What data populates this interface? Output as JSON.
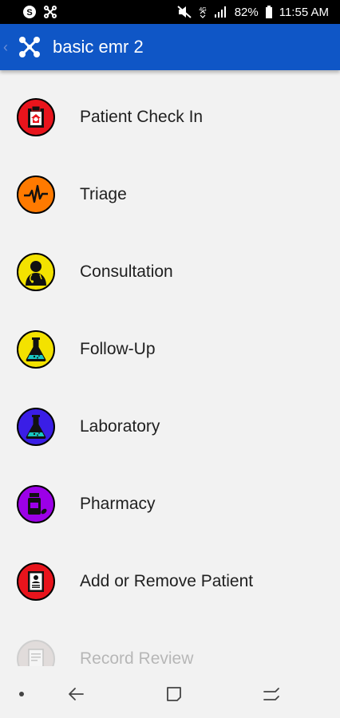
{
  "status": {
    "battery": "82%",
    "time": "11:55 AM"
  },
  "app": {
    "title": "basic emr 2"
  },
  "menu": {
    "items": [
      {
        "label": "Patient Check In",
        "color": "#e8141c",
        "icon": "clipboard-icon"
      },
      {
        "label": "Triage",
        "color": "#ff7a00",
        "icon": "heartbeat-icon"
      },
      {
        "label": "Consultation",
        "color": "#f3e200",
        "icon": "doctor-icon"
      },
      {
        "label": "Follow-Up",
        "color": "#f3e200",
        "icon": "flask-icon"
      },
      {
        "label": "Laboratory",
        "color": "#3a1ee6",
        "icon": "flask-icon"
      },
      {
        "label": "Pharmacy",
        "color": "#9c00e8",
        "icon": "medicine-bottle-icon"
      },
      {
        "label": "Add or Remove Patient",
        "color": "#e8141c",
        "icon": "id-card-icon"
      },
      {
        "label": "Record Review",
        "color": "#b8a7a1",
        "icon": "record-icon"
      }
    ]
  }
}
